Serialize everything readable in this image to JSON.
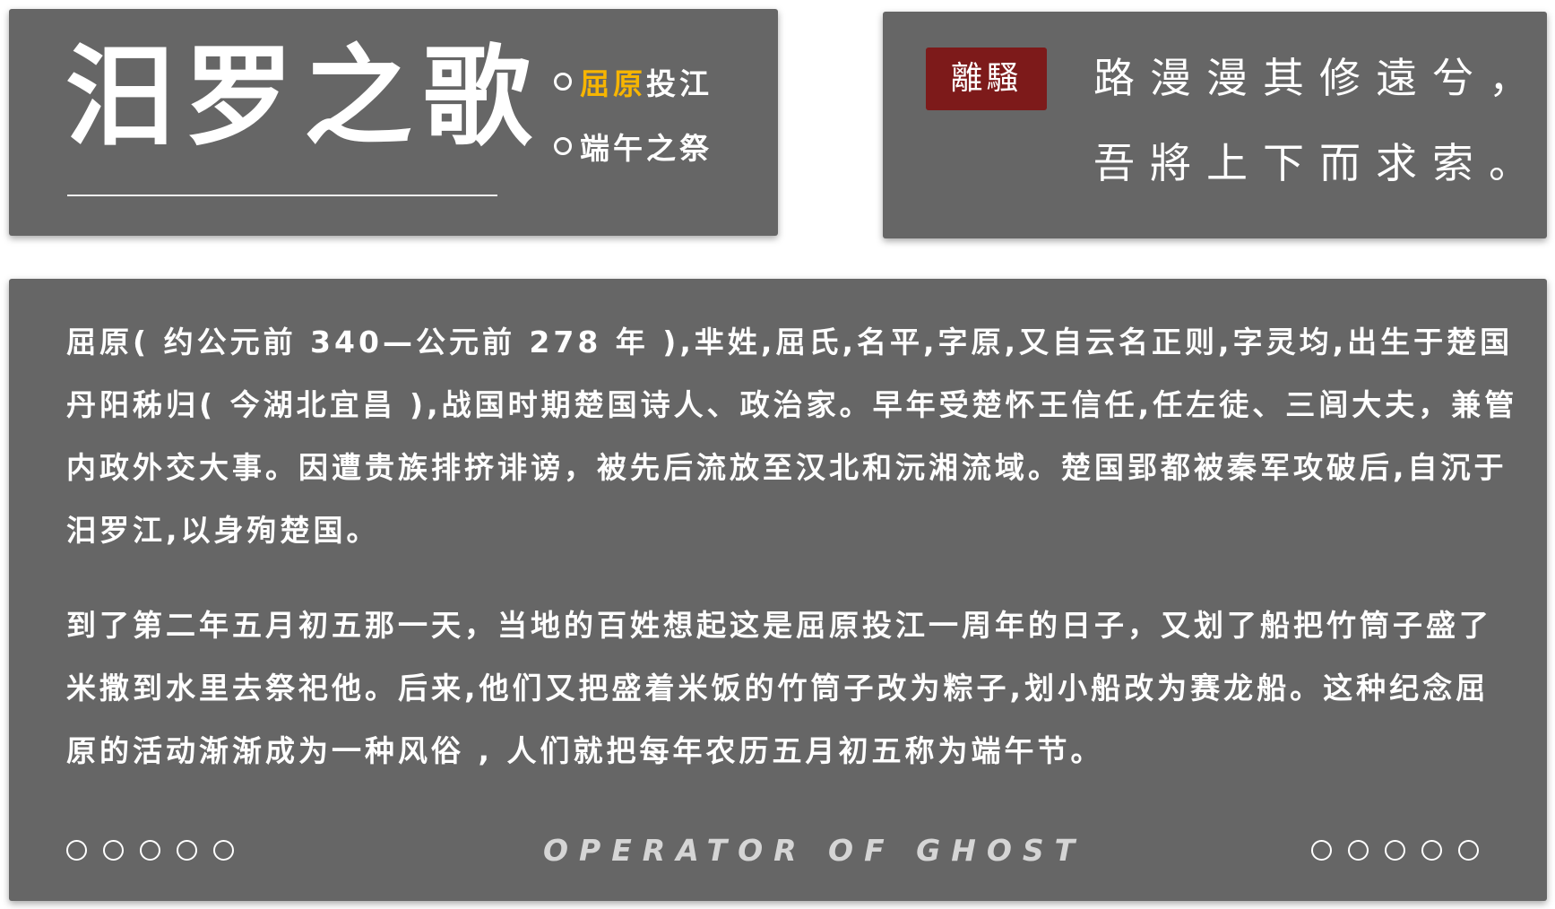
{
  "header": {
    "title": "汨罗之歌",
    "menu": [
      {
        "highlight": "屈原",
        "rest": "投江"
      },
      {
        "highlight": "",
        "rest": "端午之祭"
      }
    ],
    "colors": {
      "panel": "#666666",
      "text": "#ffffff",
      "accent": "#f7b500"
    },
    "icons": {
      "bullet": "circle-outline-icon"
    }
  },
  "poem": {
    "seal": "離騷",
    "seal_color": "#7d1a1a",
    "lines": [
      "路漫漫其修遠兮，",
      "吾將上下而求索。"
    ]
  },
  "article": {
    "paragraphs": [
      "屈原( 约公元前 340—公元前 278 年 ),芈姓,屈氏,名平,字原,又自云名正则,字灵均,出生于楚国丹阳秭归( 今湖北宜昌 ),战国时期楚国诗人、政治家。早年受楚怀王信任,任左徒、三闾大夫，兼管内政外交大事。因遭贵族排挤诽谤，被先后流放至汉北和沅湘流域。楚国郢都被秦军攻破后,自沉于汨罗江,以身殉楚国。",
      "到了第二年五月初五那一天，当地的百姓想起这是屈原投江一周年的日子，又划了船把竹筒子盛了米撒到水里去祭祀他。后来,他们又把盛着米饭的竹筒子改为粽子,划小船改为赛龙船。这种纪念屈原的活动渐渐成为一种风俗 , 人们就把每年农历五月初五称为端午节。"
    ],
    "footer": {
      "text": "OPERATOR OF GHOST",
      "text_color": "#d5d5d5",
      "dot_icon": "circle-outline-icon"
    }
  }
}
